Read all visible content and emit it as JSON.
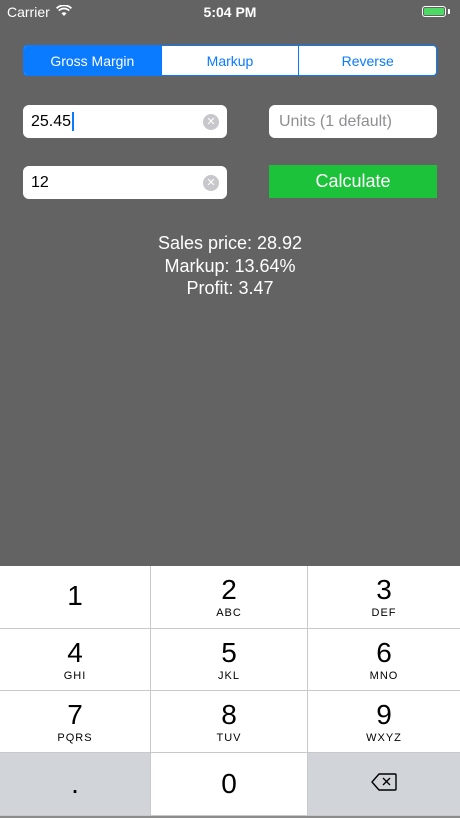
{
  "status": {
    "carrier": "Carrier",
    "time": "5:04 PM"
  },
  "tabs": [
    {
      "label": "Gross Margin",
      "active": true
    },
    {
      "label": "Markup",
      "active": false
    },
    {
      "label": "Reverse",
      "active": false
    }
  ],
  "inputs": {
    "cost": "25.45",
    "units_placeholder": "Units (1 default)",
    "margin": "12"
  },
  "calculate_label": "Calculate",
  "results": {
    "sales_price": "Sales price: 28.92",
    "markup": "Markup: 13.64%",
    "profit": "Profit: 3.47"
  },
  "keyboard": {
    "keys": [
      {
        "digit": "1",
        "letters": ""
      },
      {
        "digit": "2",
        "letters": "ABC"
      },
      {
        "digit": "3",
        "letters": "DEF"
      },
      {
        "digit": "4",
        "letters": "GHI"
      },
      {
        "digit": "5",
        "letters": "JKL"
      },
      {
        "digit": "6",
        "letters": "MNO"
      },
      {
        "digit": "7",
        "letters": "PQRS"
      },
      {
        "digit": "8",
        "letters": "TUV"
      },
      {
        "digit": "9",
        "letters": "WXYZ"
      }
    ],
    "decimal": ".",
    "zero": "0"
  },
  "icons": {
    "wifi": "wifi-icon",
    "battery": "battery-icon",
    "clear": "clear-circle-icon",
    "backspace": "backspace-icon"
  },
  "colors": {
    "accent": "#0a7aff",
    "calculate": "#1cc33a",
    "background": "#636363"
  }
}
